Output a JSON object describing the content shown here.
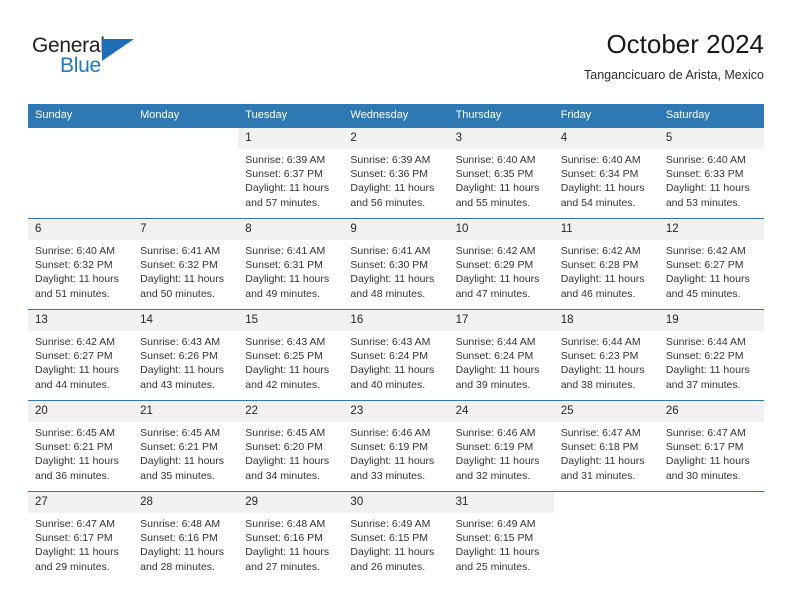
{
  "brand": {
    "name_part1": "General",
    "name_part2": "Blue",
    "triangle_icon": "triangle-icon",
    "color_dark": "#231f20",
    "color_blue": "#1f7ac0"
  },
  "header": {
    "title": "October 2024",
    "subtitle": "Tangancicuaro de Arista, Mexico"
  },
  "theme": {
    "header_blue": "#2e78b4",
    "daynum_gray": "#f1f1f1",
    "text": "#333333"
  },
  "calendar": {
    "columns": [
      "Sunday",
      "Monday",
      "Tuesday",
      "Wednesday",
      "Thursday",
      "Friday",
      "Saturday"
    ],
    "labels": {
      "sunrise": "Sunrise:",
      "sunset": "Sunset:",
      "daylight": "Daylight:"
    },
    "weeks": [
      [
        {
          "day": ""
        },
        {
          "day": ""
        },
        {
          "day": "1",
          "sunrise": "Sunrise: 6:39 AM",
          "sunset": "Sunset: 6:37 PM",
          "daylight_line1": "Daylight: 11 hours",
          "daylight_line2": "and 57 minutes."
        },
        {
          "day": "2",
          "sunrise": "Sunrise: 6:39 AM",
          "sunset": "Sunset: 6:36 PM",
          "daylight_line1": "Daylight: 11 hours",
          "daylight_line2": "and 56 minutes."
        },
        {
          "day": "3",
          "sunrise": "Sunrise: 6:40 AM",
          "sunset": "Sunset: 6:35 PM",
          "daylight_line1": "Daylight: 11 hours",
          "daylight_line2": "and 55 minutes."
        },
        {
          "day": "4",
          "sunrise": "Sunrise: 6:40 AM",
          "sunset": "Sunset: 6:34 PM",
          "daylight_line1": "Daylight: 11 hours",
          "daylight_line2": "and 54 minutes."
        },
        {
          "day": "5",
          "sunrise": "Sunrise: 6:40 AM",
          "sunset": "Sunset: 6:33 PM",
          "daylight_line1": "Daylight: 11 hours",
          "daylight_line2": "and 53 minutes."
        }
      ],
      [
        {
          "day": "6",
          "sunrise": "Sunrise: 6:40 AM",
          "sunset": "Sunset: 6:32 PM",
          "daylight_line1": "Daylight: 11 hours",
          "daylight_line2": "and 51 minutes."
        },
        {
          "day": "7",
          "sunrise": "Sunrise: 6:41 AM",
          "sunset": "Sunset: 6:32 PM",
          "daylight_line1": "Daylight: 11 hours",
          "daylight_line2": "and 50 minutes."
        },
        {
          "day": "8",
          "sunrise": "Sunrise: 6:41 AM",
          "sunset": "Sunset: 6:31 PM",
          "daylight_line1": "Daylight: 11 hours",
          "daylight_line2": "and 49 minutes."
        },
        {
          "day": "9",
          "sunrise": "Sunrise: 6:41 AM",
          "sunset": "Sunset: 6:30 PM",
          "daylight_line1": "Daylight: 11 hours",
          "daylight_line2": "and 48 minutes."
        },
        {
          "day": "10",
          "sunrise": "Sunrise: 6:42 AM",
          "sunset": "Sunset: 6:29 PM",
          "daylight_line1": "Daylight: 11 hours",
          "daylight_line2": "and 47 minutes."
        },
        {
          "day": "11",
          "sunrise": "Sunrise: 6:42 AM",
          "sunset": "Sunset: 6:28 PM",
          "daylight_line1": "Daylight: 11 hours",
          "daylight_line2": "and 46 minutes."
        },
        {
          "day": "12",
          "sunrise": "Sunrise: 6:42 AM",
          "sunset": "Sunset: 6:27 PM",
          "daylight_line1": "Daylight: 11 hours",
          "daylight_line2": "and 45 minutes."
        }
      ],
      [
        {
          "day": "13",
          "sunrise": "Sunrise: 6:42 AM",
          "sunset": "Sunset: 6:27 PM",
          "daylight_line1": "Daylight: 11 hours",
          "daylight_line2": "and 44 minutes."
        },
        {
          "day": "14",
          "sunrise": "Sunrise: 6:43 AM",
          "sunset": "Sunset: 6:26 PM",
          "daylight_line1": "Daylight: 11 hours",
          "daylight_line2": "and 43 minutes."
        },
        {
          "day": "15",
          "sunrise": "Sunrise: 6:43 AM",
          "sunset": "Sunset: 6:25 PM",
          "daylight_line1": "Daylight: 11 hours",
          "daylight_line2": "and 42 minutes."
        },
        {
          "day": "16",
          "sunrise": "Sunrise: 6:43 AM",
          "sunset": "Sunset: 6:24 PM",
          "daylight_line1": "Daylight: 11 hours",
          "daylight_line2": "and 40 minutes."
        },
        {
          "day": "17",
          "sunrise": "Sunrise: 6:44 AM",
          "sunset": "Sunset: 6:24 PM",
          "daylight_line1": "Daylight: 11 hours",
          "daylight_line2": "and 39 minutes."
        },
        {
          "day": "18",
          "sunrise": "Sunrise: 6:44 AM",
          "sunset": "Sunset: 6:23 PM",
          "daylight_line1": "Daylight: 11 hours",
          "daylight_line2": "and 38 minutes."
        },
        {
          "day": "19",
          "sunrise": "Sunrise: 6:44 AM",
          "sunset": "Sunset: 6:22 PM",
          "daylight_line1": "Daylight: 11 hours",
          "daylight_line2": "and 37 minutes."
        }
      ],
      [
        {
          "day": "20",
          "sunrise": "Sunrise: 6:45 AM",
          "sunset": "Sunset: 6:21 PM",
          "daylight_line1": "Daylight: 11 hours",
          "daylight_line2": "and 36 minutes."
        },
        {
          "day": "21",
          "sunrise": "Sunrise: 6:45 AM",
          "sunset": "Sunset: 6:21 PM",
          "daylight_line1": "Daylight: 11 hours",
          "daylight_line2": "and 35 minutes."
        },
        {
          "day": "22",
          "sunrise": "Sunrise: 6:45 AM",
          "sunset": "Sunset: 6:20 PM",
          "daylight_line1": "Daylight: 11 hours",
          "daylight_line2": "and 34 minutes."
        },
        {
          "day": "23",
          "sunrise": "Sunrise: 6:46 AM",
          "sunset": "Sunset: 6:19 PM",
          "daylight_line1": "Daylight: 11 hours",
          "daylight_line2": "and 33 minutes."
        },
        {
          "day": "24",
          "sunrise": "Sunrise: 6:46 AM",
          "sunset": "Sunset: 6:19 PM",
          "daylight_line1": "Daylight: 11 hours",
          "daylight_line2": "and 32 minutes."
        },
        {
          "day": "25",
          "sunrise": "Sunrise: 6:47 AM",
          "sunset": "Sunset: 6:18 PM",
          "daylight_line1": "Daylight: 11 hours",
          "daylight_line2": "and 31 minutes."
        },
        {
          "day": "26",
          "sunrise": "Sunrise: 6:47 AM",
          "sunset": "Sunset: 6:17 PM",
          "daylight_line1": "Daylight: 11 hours",
          "daylight_line2": "and 30 minutes."
        }
      ],
      [
        {
          "day": "27",
          "sunrise": "Sunrise: 6:47 AM",
          "sunset": "Sunset: 6:17 PM",
          "daylight_line1": "Daylight: 11 hours",
          "daylight_line2": "and 29 minutes."
        },
        {
          "day": "28",
          "sunrise": "Sunrise: 6:48 AM",
          "sunset": "Sunset: 6:16 PM",
          "daylight_line1": "Daylight: 11 hours",
          "daylight_line2": "and 28 minutes."
        },
        {
          "day": "29",
          "sunrise": "Sunrise: 6:48 AM",
          "sunset": "Sunset: 6:16 PM",
          "daylight_line1": "Daylight: 11 hours",
          "daylight_line2": "and 27 minutes."
        },
        {
          "day": "30",
          "sunrise": "Sunrise: 6:49 AM",
          "sunset": "Sunset: 6:15 PM",
          "daylight_line1": "Daylight: 11 hours",
          "daylight_line2": "and 26 minutes."
        },
        {
          "day": "31",
          "sunrise": "Sunrise: 6:49 AM",
          "sunset": "Sunset: 6:15 PM",
          "daylight_line1": "Daylight: 11 hours",
          "daylight_line2": "and 25 minutes."
        },
        {
          "day": ""
        },
        {
          "day": ""
        }
      ]
    ]
  }
}
